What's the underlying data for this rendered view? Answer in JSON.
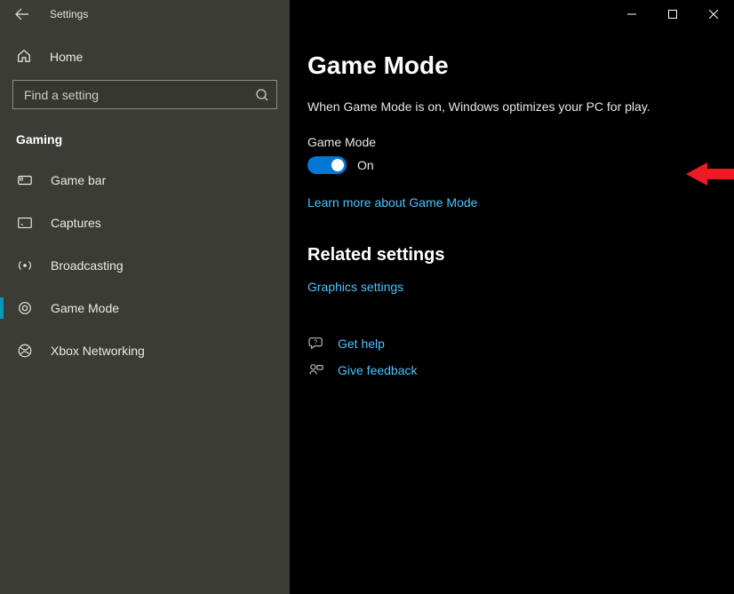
{
  "app": {
    "title": "Settings"
  },
  "sidebar": {
    "home_label": "Home",
    "search_placeholder": "Find a setting",
    "category": "Gaming",
    "items": [
      {
        "label": "Game bar"
      },
      {
        "label": "Captures"
      },
      {
        "label": "Broadcasting"
      },
      {
        "label": "Game Mode"
      },
      {
        "label": "Xbox Networking"
      }
    ]
  },
  "main": {
    "title": "Game Mode",
    "description": "When Game Mode is on, Windows optimizes your PC for play.",
    "toggle_label": "Game Mode",
    "toggle_state": "On",
    "learn_more": "Learn more about Game Mode",
    "related_heading": "Related settings",
    "related_link": "Graphics settings",
    "help_get": "Get help",
    "help_feedback": "Give feedback"
  },
  "accent_color": "#0078d4",
  "link_color": "#4cc2ff"
}
